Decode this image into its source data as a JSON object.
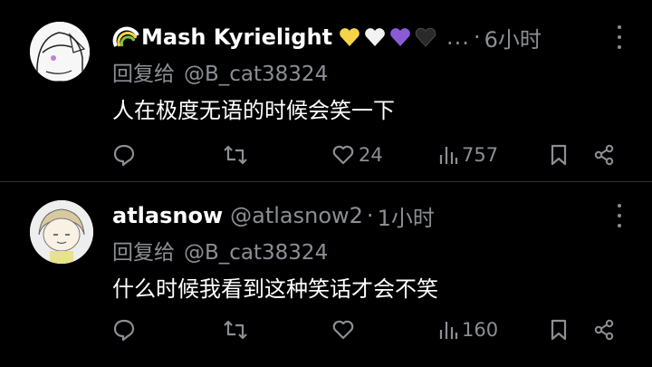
{
  "posts": [
    {
      "name": "Mash Kyrielight",
      "name_prefix_icon": "rainbow-icon",
      "hearts": [
        "yellow",
        "white",
        "purple",
        "black"
      ],
      "ellipsis": "...",
      "time": "6小时",
      "reply_label": "回复给",
      "reply_to": "@B_cat38324",
      "content": "人在极度无语的时候会笑一下",
      "likes": "24",
      "views": "757"
    },
    {
      "name": "atlasnow",
      "handle": "@atlasnow2",
      "time": "1小时",
      "reply_label": "回复给",
      "reply_to": "@B_cat38324",
      "content": "什么时候我看到这种笑话才会不笑",
      "views": "160"
    }
  ],
  "colors": {
    "background": "#000000",
    "text": "#e7e9ea",
    "muted": "#8b8f94",
    "heart_yellow": "#f5d547",
    "heart_white": "#f2f2f2",
    "heart_purple": "#8b5bd6",
    "heart_black": "#2a2a2a"
  }
}
